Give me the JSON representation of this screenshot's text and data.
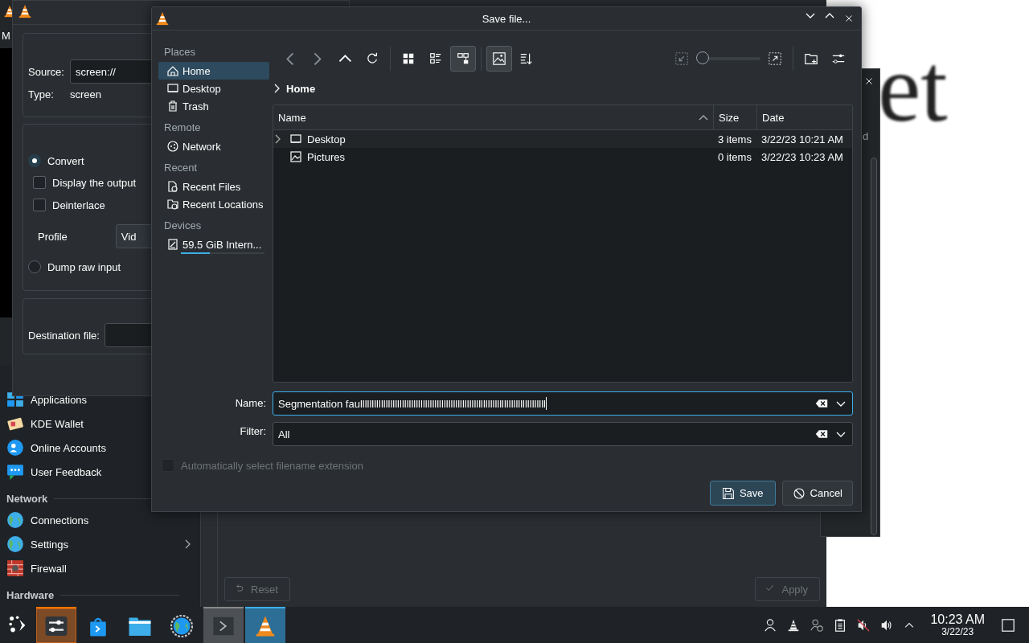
{
  "background_vlc": {
    "menu_letter": "M"
  },
  "desktop": {
    "text": "et"
  },
  "settings_window": {
    "sidebar": [
      {
        "kind": "item",
        "label": "Applications"
      },
      {
        "kind": "item",
        "label": "KDE Wallet"
      },
      {
        "kind": "item",
        "label": "Online Accounts"
      },
      {
        "kind": "item",
        "label": "User Feedback"
      },
      {
        "kind": "header",
        "label": "Network"
      },
      {
        "kind": "item",
        "label": "Connections",
        "expandable": false
      },
      {
        "kind": "item",
        "label": "Settings",
        "expandable": true
      },
      {
        "kind": "item",
        "label": "Firewall",
        "expandable": false
      },
      {
        "kind": "header",
        "label": "Hardware"
      }
    ],
    "buttons": [
      {
        "label": "Reset",
        "disabled": true
      },
      {
        "label": "Apply",
        "disabled": true
      }
    ]
  },
  "side_dialog": {
    "partial_text": "d"
  },
  "convert_dialog": {
    "source_label": "Source:",
    "source_value": "screen://",
    "type_label": "Type:",
    "type_value": "screen",
    "options": [
      {
        "kind": "radio",
        "label": "Convert",
        "selected": true
      },
      {
        "kind": "checkbox",
        "label": "Display the output",
        "checked": false
      },
      {
        "kind": "checkbox",
        "label": "Deinterlace",
        "checked": false
      },
      {
        "kind": "combo",
        "label": "Profile",
        "value": "Vid"
      },
      {
        "kind": "radio",
        "label": "Dump raw input",
        "selected": false
      }
    ],
    "destination_label": "Destination file:"
  },
  "save_dialog": {
    "title": "Save file...",
    "places": [
      {
        "heading": "Places",
        "items": [
          {
            "label": "Home",
            "selected": true
          },
          {
            "label": "Desktop",
            "selected": false
          },
          {
            "label": "Trash",
            "selected": false
          }
        ]
      },
      {
        "heading": "Remote",
        "items": [
          {
            "label": "Network",
            "selected": false
          }
        ]
      },
      {
        "heading": "Recent",
        "items": [
          {
            "label": "Recent Files",
            "selected": false
          },
          {
            "label": "Recent Locations",
            "selected": false
          }
        ]
      },
      {
        "heading": "Devices",
        "items": [
          {
            "label": "59.5 GiB Intern...",
            "selected": false,
            "level": 0.35
          }
        ]
      }
    ],
    "view_modes": [
      {
        "selected": false
      },
      {
        "selected": false
      },
      {
        "selected": true
      }
    ],
    "preview": {
      "on": true
    },
    "zoom": {
      "level": 0.0
    },
    "breadcrumb": "Home",
    "columns": [
      {
        "label": "Name",
        "sorted": true
      },
      {
        "label": "Size",
        "sorted": false
      },
      {
        "label": "Date",
        "sorted": false
      }
    ],
    "rows": [
      {
        "name": "Desktop",
        "size": "3 items",
        "date": "3/22/23 10:21 AM",
        "expandable": true
      },
      {
        "name": "Pictures",
        "size": "0 items",
        "date": "3/22/23 10:23 AM",
        "expandable": false
      }
    ],
    "name_label": "Name:",
    "name_value": "Segmentation faullllllllllllllllllllllllllllllllllllllllllllllllllllllllllllllllllllllllllllllll",
    "filter_label": "Filter:",
    "filter_value": "All",
    "auto_extension": {
      "label": "Automatically select filename extension",
      "checked": false,
      "disabled": true
    },
    "buttons": [
      {
        "label": "Save",
        "default": true
      },
      {
        "label": "Cancel",
        "default": false
      }
    ]
  },
  "taskbar": {
    "tasks": [
      {
        "attention": true,
        "open": true,
        "selected": false
      },
      {
        "attention": false,
        "open": false,
        "selected": false
      },
      {
        "attention": false,
        "open": false,
        "selected": false
      },
      {
        "attention": false,
        "open": false,
        "selected": false
      },
      {
        "attention": false,
        "open": true,
        "selected": false
      },
      {
        "attention": false,
        "open": true,
        "selected": true
      }
    ],
    "time": "10:23 AM",
    "date": "3/22/23"
  }
}
